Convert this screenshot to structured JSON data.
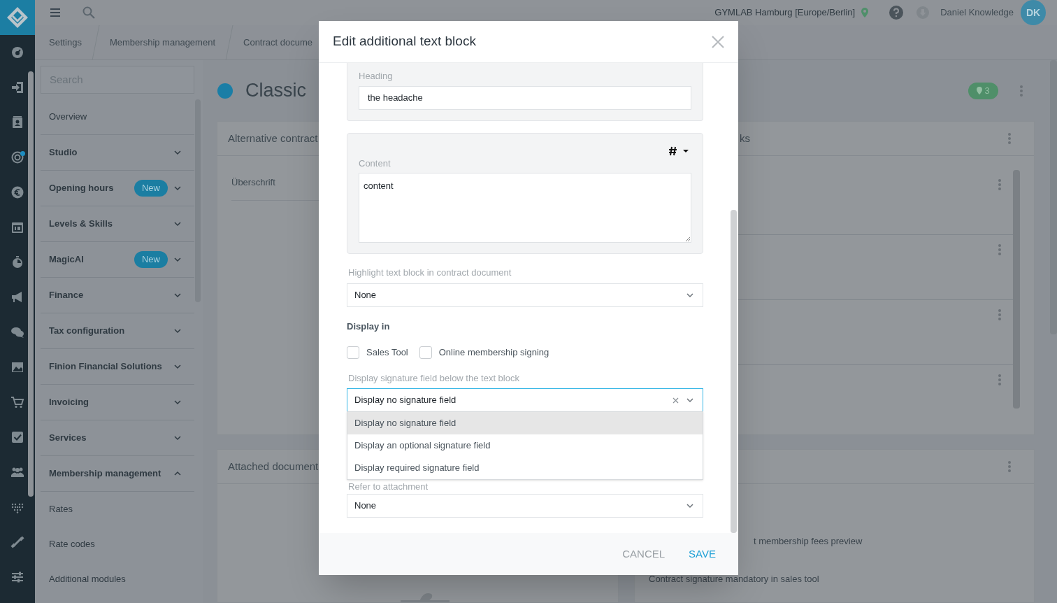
{
  "rail": [
    {
      "dot": false
    },
    {
      "dot": false
    },
    {
      "dot": false
    },
    {
      "dot": true
    },
    {
      "dot": false
    },
    {
      "dot": false
    },
    {
      "dot": false
    },
    {
      "dot": false
    },
    {
      "dot": false
    },
    {
      "dot": false
    },
    {
      "dot": false
    },
    {
      "dot": false
    },
    {
      "dot": false
    },
    {
      "dot": false
    },
    {
      "dot": false
    },
    {
      "dot": false
    }
  ],
  "topbar": {
    "location": "GYMLAB Hamburg [Europe/Berlin]",
    "user": "Daniel Knowledge",
    "initials": "DK"
  },
  "breadcrumbs": [
    "Settings",
    "Membership management",
    "Contract docume"
  ],
  "sidebar": {
    "search_placeholder": "Search",
    "items": [
      {
        "label": "Overview",
        "kind": "link"
      },
      {
        "label": "Studio",
        "kind": "group",
        "expanded": false
      },
      {
        "label": "Opening hours",
        "kind": "group",
        "expanded": false,
        "badge": "New"
      },
      {
        "label": "Levels & Skills",
        "kind": "group",
        "expanded": false
      },
      {
        "label": "MagicAI",
        "kind": "group",
        "expanded": false,
        "badge": "New"
      },
      {
        "label": "Finance",
        "kind": "group",
        "expanded": false
      },
      {
        "label": "Tax configuration",
        "kind": "group",
        "expanded": false
      },
      {
        "label": "Finion Financial Solutions",
        "kind": "group",
        "expanded": false
      },
      {
        "label": "Invoicing",
        "kind": "group",
        "expanded": false
      },
      {
        "label": "Services",
        "kind": "group",
        "expanded": false
      },
      {
        "label": "Membership management",
        "kind": "group",
        "expanded": true,
        "children": [
          {
            "label": "Rates"
          },
          {
            "label": "Rate codes"
          },
          {
            "label": "Additional modules"
          }
        ]
      }
    ]
  },
  "page": {
    "title": "Classic",
    "location_count": "3"
  },
  "panels": [
    {
      "left_title": "Alternative contract",
      "left_rows": [
        "Überschrift"
      ],
      "right_title": "ks"
    },
    {
      "left_title": "Attached document",
      "right_texts": [
        "t membership fees preview",
        "Contract signature mandatory in sales tool"
      ]
    }
  ],
  "modal": {
    "title": "Edit additional text block",
    "heading": {
      "label": "Heading",
      "value": "the headache"
    },
    "content": {
      "label": "Content",
      "value": "content"
    },
    "highlight": {
      "label": "Highlight text block in contract document",
      "value": "None"
    },
    "display_in": {
      "label": "Display in",
      "options": [
        {
          "label": "Sales Tool",
          "checked": false
        },
        {
          "label": "Online membership signing",
          "checked": false
        }
      ]
    },
    "signature": {
      "label": "Display signature field below the text block",
      "value": "Display no signature field",
      "open": true,
      "options": [
        {
          "label": "Display no signature field",
          "selected": true
        },
        {
          "label": "Display an optional signature field",
          "selected": false
        },
        {
          "label": "Display required signature field",
          "selected": false
        }
      ]
    },
    "attachment": {
      "label": "Refer to attachment",
      "value": "None"
    },
    "buttons": [
      {
        "label": "CANCEL",
        "kind": "secondary"
      },
      {
        "label": "SAVE",
        "kind": "primary"
      }
    ]
  }
}
